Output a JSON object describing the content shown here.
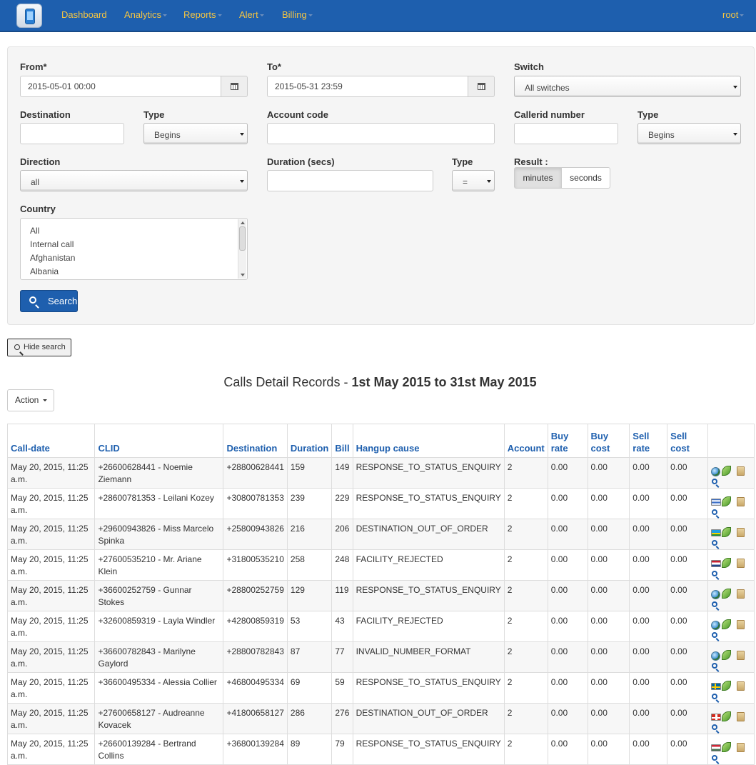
{
  "nav": {
    "items": [
      {
        "label": "Dashboard",
        "dropdown": false
      },
      {
        "label": "Analytics",
        "dropdown": true
      },
      {
        "label": "Reports",
        "dropdown": true
      },
      {
        "label": "Alert",
        "dropdown": true
      },
      {
        "label": "Billing",
        "dropdown": true
      }
    ],
    "user": "root",
    "colors": {
      "bar": "#1e5fae",
      "link": "#f5c542"
    }
  },
  "search": {
    "from_label": "From*",
    "from_value": "2015-05-01 00:00",
    "to_label": "To*",
    "to_value": "2015-05-31 23:59",
    "switch_label": "Switch",
    "switch_value": "All switches",
    "destination_label": "Destination",
    "destination_value": "",
    "dest_type_label": "Type",
    "dest_type_value": "Begins",
    "account_code_label": "Account code",
    "account_code_value": "",
    "callerid_label": "Callerid number",
    "callerid_value": "",
    "callerid_type_label": "Type",
    "callerid_type_value": "Begins",
    "direction_label": "Direction",
    "direction_value": "all",
    "duration_label": "Duration (secs)",
    "duration_value": "",
    "duration_type_label": "Type",
    "duration_type_value": "=",
    "result_label": "Result :",
    "result_options": [
      "minutes",
      "seconds"
    ],
    "result_selected": "minutes",
    "country_label": "Country",
    "country_options": [
      "All",
      "Internal call",
      "Afghanistan",
      "Albania"
    ],
    "search_button": "Search",
    "hide_button": "Hide search"
  },
  "page": {
    "title_prefix": "Calls Detail Records - ",
    "title_range": "1st May 2015 to 31st May 2015",
    "action_button": "Action"
  },
  "table": {
    "headers": [
      "Call-date",
      "CLID",
      "Destination",
      "Duration",
      "Bill",
      "Hangup cause",
      "Account",
      "Buy rate",
      "Buy cost",
      "Sell rate",
      "Sell cost",
      ""
    ],
    "rows": [
      {
        "date": "May 20, 2015, 11:25 a.m.",
        "clid": "+26600628441 - Noemie Ziemann",
        "destination": "+28800628441",
        "duration": "159",
        "bill": "149",
        "hangup": "RESPONSE_TO_STATUS_ENQUIRY",
        "account": "2",
        "buy_rate": "0.00",
        "buy_cost": "0.00",
        "sell_rate": "0.00",
        "sell_cost": "0.00",
        "flag": "globe"
      },
      {
        "date": "May 20, 2015, 11:25 a.m.",
        "clid": "+28600781353 - Leilani Kozey",
        "destination": "+30800781353",
        "duration": "239",
        "bill": "229",
        "hangup": "RESPONSE_TO_STATUS_ENQUIRY",
        "account": "2",
        "buy_rate": "0.00",
        "buy_cost": "0.00",
        "sell_rate": "0.00",
        "sell_cost": "0.00",
        "flag": "greece"
      },
      {
        "date": "May 20, 2015, 11:25 a.m.",
        "clid": "+29600943826 - Miss Marcelo Spinka",
        "destination": "+25800943826",
        "duration": "216",
        "bill": "206",
        "hangup": "DESTINATION_OUT_OF_ORDER",
        "account": "2",
        "buy_rate": "0.00",
        "buy_cost": "0.00",
        "sell_rate": "0.00",
        "sell_cost": "0.00",
        "flag": "rwanda"
      },
      {
        "date": "May 20, 2015, 11:25 a.m.",
        "clid": "+27600535210 - Mr. Ariane Klein",
        "destination": "+31800535210",
        "duration": "258",
        "bill": "248",
        "hangup": "FACILITY_REJECTED",
        "account": "2",
        "buy_rate": "0.00",
        "buy_cost": "0.00",
        "sell_rate": "0.00",
        "sell_cost": "0.00",
        "flag": "netherlands"
      },
      {
        "date": "May 20, 2015, 11:25 a.m.",
        "clid": "+36600252759 - Gunnar Stokes",
        "destination": "+28800252759",
        "duration": "129",
        "bill": "119",
        "hangup": "RESPONSE_TO_STATUS_ENQUIRY",
        "account": "2",
        "buy_rate": "0.00",
        "buy_cost": "0.00",
        "sell_rate": "0.00",
        "sell_cost": "0.00",
        "flag": "globe"
      },
      {
        "date": "May 20, 2015, 11:25 a.m.",
        "clid": "+32600859319 - Layla Windler",
        "destination": "+42800859319",
        "duration": "53",
        "bill": "43",
        "hangup": "FACILITY_REJECTED",
        "account": "2",
        "buy_rate": "0.00",
        "buy_cost": "0.00",
        "sell_rate": "0.00",
        "sell_cost": "0.00",
        "flag": "globe"
      },
      {
        "date": "May 20, 2015, 11:25 a.m.",
        "clid": "+36600782843 - Marilyne Gaylord",
        "destination": "+28800782843",
        "duration": "87",
        "bill": "77",
        "hangup": "INVALID_NUMBER_FORMAT",
        "account": "2",
        "buy_rate": "0.00",
        "buy_cost": "0.00",
        "sell_rate": "0.00",
        "sell_cost": "0.00",
        "flag": "globe"
      },
      {
        "date": "May 20, 2015, 11:25 a.m.",
        "clid": "+36600495334 - Alessia Collier",
        "destination": "+46800495334",
        "duration": "69",
        "bill": "59",
        "hangup": "RESPONSE_TO_STATUS_ENQUIRY",
        "account": "2",
        "buy_rate": "0.00",
        "buy_cost": "0.00",
        "sell_rate": "0.00",
        "sell_cost": "0.00",
        "flag": "sweden"
      },
      {
        "date": "May 20, 2015, 11:25 a.m.",
        "clid": "+27600658127 - Audreanne Kovacek",
        "destination": "+41800658127",
        "duration": "286",
        "bill": "276",
        "hangup": "DESTINATION_OUT_OF_ORDER",
        "account": "2",
        "buy_rate": "0.00",
        "buy_cost": "0.00",
        "sell_rate": "0.00",
        "sell_cost": "0.00",
        "flag": "switzerland"
      },
      {
        "date": "May 20, 2015, 11:25 a.m.",
        "clid": "+26600139284 - Bertrand Collins",
        "destination": "+36800139284",
        "duration": "89",
        "bill": "79",
        "hangup": "RESPONSE_TO_STATUS_ENQUIRY",
        "account": "2",
        "buy_rate": "0.00",
        "buy_cost": "0.00",
        "sell_rate": "0.00",
        "sell_cost": "0.00",
        "flag": "hungary"
      }
    ],
    "row_icons": [
      "flag-icon",
      "leaf-icon",
      "document-icon",
      "magnifier-icon"
    ]
  }
}
